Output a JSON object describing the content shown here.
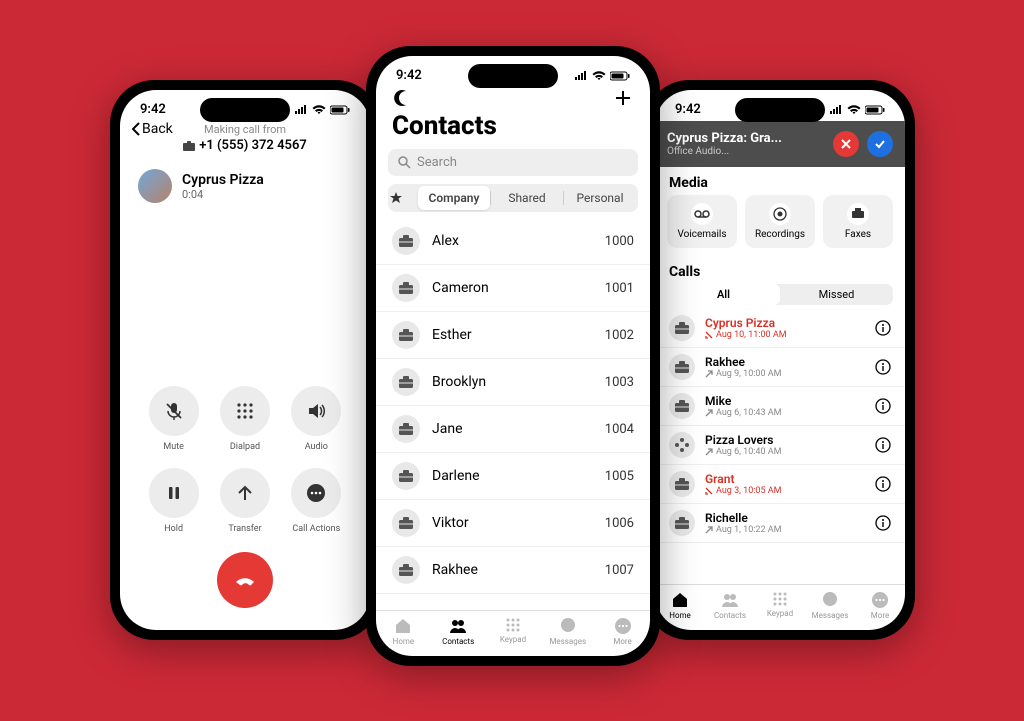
{
  "status_time": "9:42",
  "phone1": {
    "back": "Back",
    "making_from": "Making call from",
    "number": "+1 (555) 372 4567",
    "caller_name": "Cyprus Pizza",
    "duration": "0:04",
    "controls": [
      {
        "label": "Mute"
      },
      {
        "label": "Dialpad"
      },
      {
        "label": "Audio"
      },
      {
        "label": "Hold"
      },
      {
        "label": "Transfer"
      },
      {
        "label": "Call Actions"
      }
    ]
  },
  "phone2": {
    "title": "Contacts",
    "search_placeholder": "Search",
    "segments": {
      "company": "Company",
      "shared": "Shared",
      "personal": "Personal"
    },
    "contacts": [
      {
        "name": "Alex",
        "ext": "1000"
      },
      {
        "name": "Cameron",
        "ext": "1001"
      },
      {
        "name": "Esther",
        "ext": "1002"
      },
      {
        "name": "Brooklyn",
        "ext": "1003"
      },
      {
        "name": "Jane",
        "ext": "1004"
      },
      {
        "name": "Darlene",
        "ext": "1005"
      },
      {
        "name": "Viktor",
        "ext": "1006"
      },
      {
        "name": "Rakhee",
        "ext": "1007"
      }
    ],
    "tabs": {
      "home": "Home",
      "contacts": "Contacts",
      "keypad": "Keypad",
      "messages": "Messages",
      "more": "More"
    }
  },
  "phone3": {
    "banner_title": "Cyprus Pizza: Gra...",
    "banner_sub": "Office Audio...",
    "media_title": "Media",
    "media": {
      "vm": "Voicemails",
      "rec": "Recordings",
      "fax": "Faxes"
    },
    "calls_title": "Calls",
    "seg": {
      "all": "All",
      "missed": "Missed"
    },
    "calls": [
      {
        "name": "Cyprus Pizza",
        "sub": "Aug 10, 11:00 AM",
        "missed": true,
        "icon": "briefcase"
      },
      {
        "name": "Rakhee",
        "sub": "Aug 9, 10:00 AM",
        "missed": false,
        "icon": "briefcase"
      },
      {
        "name": "Mike",
        "sub": "Aug 6, 10:43 AM",
        "missed": false,
        "icon": "briefcase"
      },
      {
        "name": "Pizza Lovers",
        "sub": "Aug 6, 10:40 AM",
        "missed": false,
        "icon": "group"
      },
      {
        "name": "Grant",
        "sub": "Aug 3, 10:05 AM",
        "missed": true,
        "icon": "briefcase"
      },
      {
        "name": "Richelle",
        "sub": "Aug 1, 10:22 AM",
        "missed": false,
        "icon": "briefcase"
      }
    ],
    "tabs": {
      "home": "Home",
      "contacts": "Contacts",
      "keypad": "Keypad",
      "messages": "Messages",
      "more": "More"
    }
  }
}
